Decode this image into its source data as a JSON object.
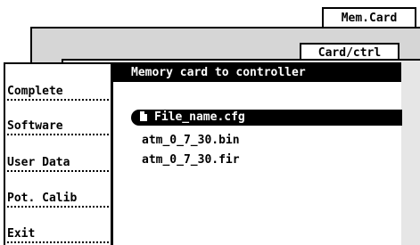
{
  "tabs": {
    "mem_card": "Mem.Card",
    "card_ctrl": "Card/ctrl"
  },
  "sidebar": {
    "items": [
      {
        "label": "Complete"
      },
      {
        "label": "Software"
      },
      {
        "label": "User Data"
      },
      {
        "label": "Pot. Calib"
      },
      {
        "label": "Exit"
      }
    ]
  },
  "content": {
    "title": "Memory card to controller",
    "files": [
      {
        "name": "File_name.cfg",
        "selected": true
      },
      {
        "name": "atm_0_7_30.bin",
        "selected": false
      },
      {
        "name": "atm_0_7_30.fir",
        "selected": false
      }
    ]
  },
  "colors": {
    "background": "#ffffff",
    "panel_outer": "#d6d6d6",
    "panel_inner": "#e6e6e6",
    "highlight": "#000000"
  }
}
